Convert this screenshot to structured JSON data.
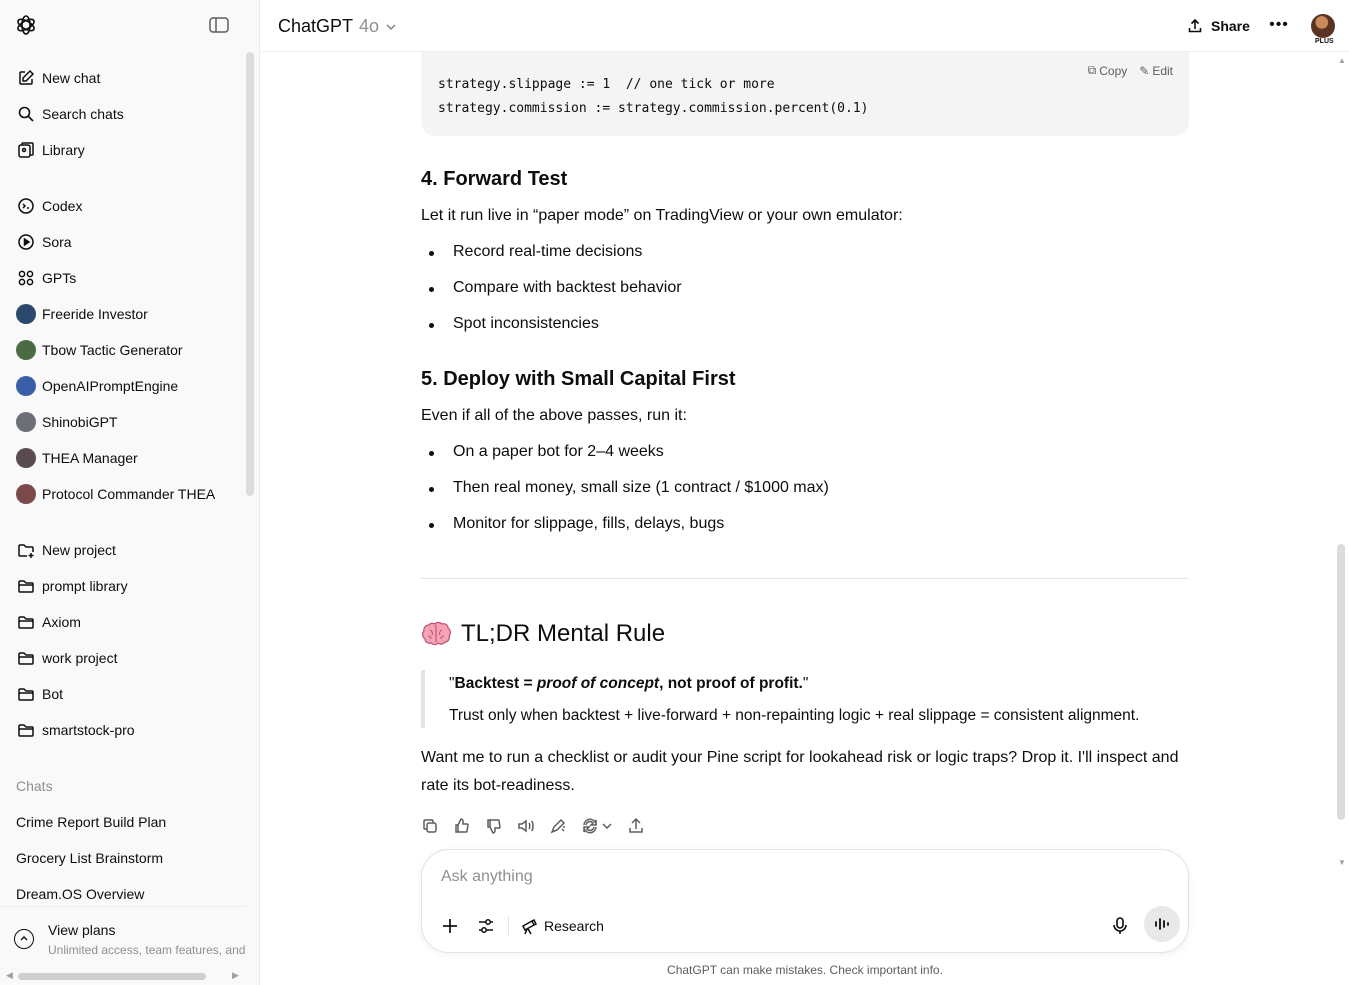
{
  "header": {
    "title": "ChatGPT",
    "model_version": "4o",
    "share_label": "Share",
    "plan_badge": "PLUS"
  },
  "sidebar": {
    "top_items": [
      {
        "label": "New chat",
        "icon": "pencil-square-icon"
      },
      {
        "label": "Search chats",
        "icon": "search-icon"
      },
      {
        "label": "Library",
        "icon": "library-icon"
      }
    ],
    "app_items": [
      {
        "label": "Codex",
        "icon": "codex-icon"
      },
      {
        "label": "Sora",
        "icon": "sora-icon"
      },
      {
        "label": "GPTs",
        "icon": "grid-icon"
      }
    ],
    "gpts": [
      {
        "label": "Freeride Investor",
        "color": "#2b4a6b"
      },
      {
        "label": "Tbow Tactic Generator",
        "color": "#4b6b45"
      },
      {
        "label": "OpenAIPromptEngine",
        "color": "#3a5fa8"
      },
      {
        "label": "ShinobiGPT",
        "color": "#6b6f78"
      },
      {
        "label": "THEA Manager",
        "color": "#5a4a52"
      },
      {
        "label": "Protocol Commander THEA",
        "color": "#7a4a4a"
      }
    ],
    "projects": [
      {
        "label": "New project",
        "icon": "folder-plus-icon"
      },
      {
        "label": "prompt library",
        "icon": "folder-icon"
      },
      {
        "label": "Axiom",
        "icon": "folder-icon"
      },
      {
        "label": "work project",
        "icon": "folder-icon"
      },
      {
        "label": "Bot",
        "icon": "folder-icon"
      },
      {
        "label": "smartstock-pro",
        "icon": "folder-icon"
      }
    ],
    "chats_heading": "Chats",
    "chats": [
      "Crime Report Build Plan",
      "Grocery List Brainstorm",
      "Dream.OS Overview"
    ],
    "footer": {
      "title": "View plans",
      "subtitle": "Unlimited access, team features, and"
    }
  },
  "code": {
    "copy_label": "Copy",
    "edit_label": "Edit",
    "lines": [
      "strategy.slippage := 1  // one tick or more",
      "strategy.commission := strategy.commission.percent(0.1)"
    ]
  },
  "content": {
    "section4": {
      "heading": "4. Forward Test",
      "intro": "Let it run live in “paper mode” on TradingView or your own emulator:",
      "bullets": [
        "Record real-time decisions",
        "Compare with backtest behavior",
        "Spot inconsistencies"
      ]
    },
    "section5": {
      "heading": "5. Deploy with Small Capital First",
      "intro": "Even if all of the above passes, run it:",
      "bullets": [
        "On a paper bot for 2–4 weeks",
        "Then real money, small size (1 contract / $1000 max)",
        "Monitor for slippage, fills, delays, bugs"
      ]
    },
    "tldr_heading": "TL;DR Mental Rule",
    "quote": {
      "open_quote": "\"",
      "lead": "Backtest = ",
      "em": "proof of concept",
      "tail": ", not proof of profit.",
      "close_quote": "\"",
      "line2": "Trust only when backtest + live-forward + non-repainting logic + real slippage = consistent alignment."
    },
    "closing": "Want me to run a checklist or audit your Pine script for lookahead risk or logic traps? Drop it. I'll inspect and rate its bot-readiness."
  },
  "composer": {
    "placeholder": "Ask anything",
    "research_label": "Research"
  },
  "disclaimer": "ChatGPT can make mistakes. Check important info."
}
